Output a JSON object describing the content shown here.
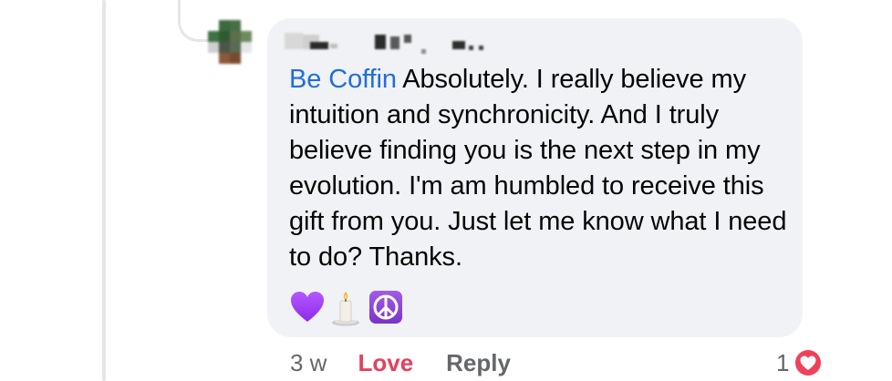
{
  "comment": {
    "mention": "Be Coffin",
    "text": " Absolutely. I really believe my intuition and synchronicity. And I truly believe finding you is the next step in my evolution. I'm am humbled to receive this gift from you. Just let me know what I need to do? Thanks.",
    "emojis": [
      "purple-heart",
      "candle",
      "peace-symbol"
    ]
  },
  "actions": {
    "time": "3 w",
    "love_label": "Love",
    "reply_label": "Reply"
  },
  "reactions": {
    "count": "1",
    "type": "love-reaction-icon"
  },
  "colors": {
    "mention": "#216fdb",
    "love": "#e4405f",
    "muted": "#65676b",
    "bubble": "#f0f2f5",
    "text": "#050505",
    "purple_heart": "#a033ff",
    "peace_bg": "#8f47d9"
  }
}
